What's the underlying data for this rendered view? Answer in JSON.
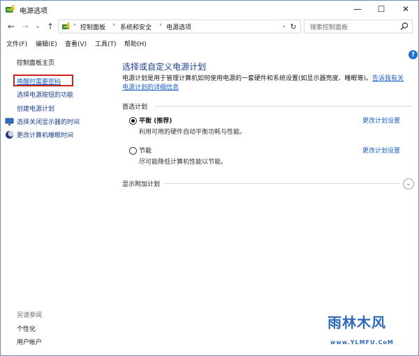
{
  "window": {
    "title": "电源选项",
    "minimize": "—",
    "maximize": "☐",
    "close": "✕"
  },
  "nav": {
    "back": "←",
    "forward": "→",
    "recent": "⌄",
    "up": "↑",
    "breadcrumbs": [
      "控制面板",
      "系统和安全",
      "电源选项"
    ],
    "separator": "›",
    "search_placeholder": "搜索控制面板"
  },
  "menu": [
    "文件(F)",
    "编辑(E)",
    "查看(V)",
    "工具(T)",
    "帮助(H)"
  ],
  "sidebar": {
    "home": "控制面板主页",
    "links": [
      "唤醒时需要密码",
      "选择电源按钮的功能",
      "创建电源计划",
      "选择关闭显示器的时间",
      "更改计算机睡眠时间"
    ],
    "see_also_heading": "另请参阅",
    "see_also": [
      "个性化",
      "用户帐户"
    ]
  },
  "main": {
    "title": "选择或自定义电源计划",
    "description_line1": "电源计划是用于管理计算机如何使用电源的一套硬件和系统设置(如显示器亮度、睡眠等)。",
    "description_link_a": "告诉我有关",
    "description_link_b": "电源计划的详细信息",
    "preferred_heading": "首选计划",
    "plans": [
      {
        "name": "平衡 (推荐)",
        "desc": "利用可用的硬件自动平衡功耗与性能。",
        "link": "更改计划设置",
        "selected": true
      },
      {
        "name": "节能",
        "desc": "尽可能降低计算机性能以节能。",
        "link": "更改计划设置",
        "selected": false
      }
    ],
    "additional_heading": "显示附加计划"
  },
  "watermark": {
    "text": "雨林木风",
    "url": "www.YLMFU.CoM"
  },
  "colors": {
    "link": "#1a5fc4",
    "highlight_border": "#d51e1e",
    "watermark": "#2c69b8"
  }
}
